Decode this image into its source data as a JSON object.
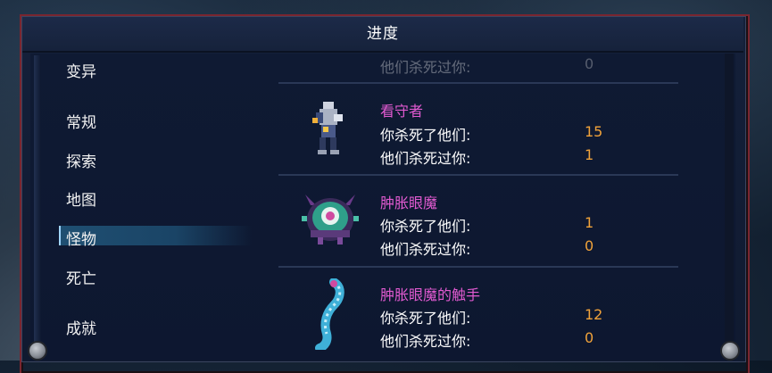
{
  "window": {
    "title": "进度"
  },
  "sidebar": {
    "items": [
      {
        "label": "变异",
        "active": false
      },
      {
        "label": "常规",
        "active": false
      },
      {
        "label": "探索",
        "active": false
      },
      {
        "label": "地图",
        "active": false
      },
      {
        "label": "怪物",
        "active": true
      },
      {
        "label": "死亡",
        "active": false
      },
      {
        "label": "成就",
        "active": false
      }
    ]
  },
  "monsters": {
    "partial": {
      "label_killed_by": "他们杀死过你:",
      "killed_by": "0"
    },
    "entries": [
      {
        "name": "看守者",
        "label_killed": "你杀死了他们:",
        "killed": "15",
        "label_killed_by": "他们杀死过你:",
        "killed_by": "1",
        "sprite": "guardian-sprite"
      },
      {
        "name": "肿胀眼魔",
        "label_killed": "你杀死了他们:",
        "killed": "1",
        "label_killed_by": "他们杀死过你:",
        "killed_by": "0",
        "sprite": "bloated-eye-demon-sprite"
      },
      {
        "name": "肿胀眼魔的触手",
        "label_killed": "你杀死了他们:",
        "killed": "12",
        "label_killed_by": "他们杀死过你:",
        "killed_by": "0",
        "sprite": "tentacle-sprite"
      }
    ]
  },
  "colors": {
    "frame_border": "#7a2630",
    "monster_name": "#e05ad0",
    "stat_value": "#f0a23a",
    "active_nav": "#1f4f72"
  }
}
